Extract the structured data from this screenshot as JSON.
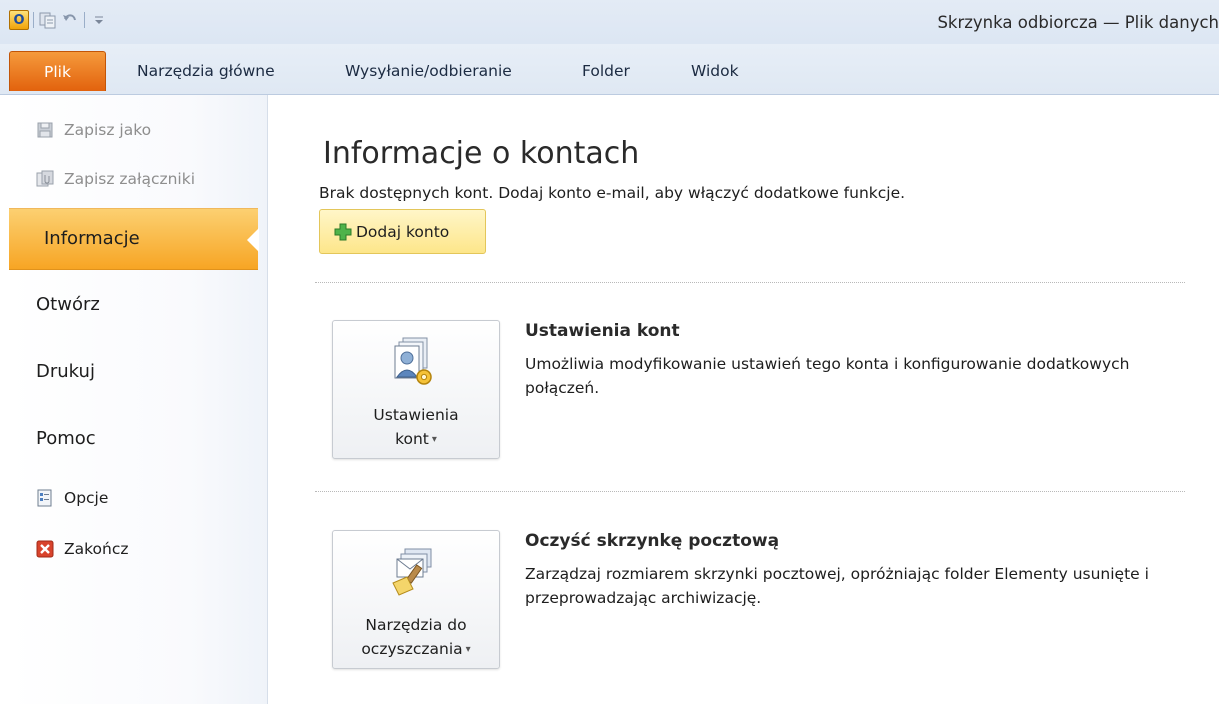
{
  "window": {
    "title": "Skrzynka odbiorcza — Plik danych"
  },
  "quick_access": {
    "icons": [
      "outlook-logo-icon",
      "send-receive-icon",
      "undo-icon",
      "customize-qat-icon"
    ]
  },
  "ribbon": {
    "tabs": [
      {
        "label": "Plik",
        "active": true
      },
      {
        "label": "Narzędzia główne"
      },
      {
        "label": "Wysyłanie/odbieranie"
      },
      {
        "label": "Folder"
      },
      {
        "label": "Widok"
      }
    ]
  },
  "nav": {
    "save_as": "Zapisz jako",
    "save_attachments": "Zapisz załączniki",
    "info": "Informacje",
    "open": "Otwórz",
    "print": "Drukuj",
    "help": "Pomoc",
    "options": "Opcje",
    "exit": "Zakończ"
  },
  "main": {
    "title": "Informacje o kontach",
    "subtitle": "Brak dostępnych kont. Dodaj konto e-mail, aby włączyć dodatkowe funkcje.",
    "add_account_label": "Dodaj konto",
    "sections": [
      {
        "button_line1": "Ustawienia",
        "button_line2": "kont",
        "heading": "Ustawienia kont",
        "description": "Umożliwia modyfikowanie ustawień tego konta i konfigurowanie dodatkowych połączeń."
      },
      {
        "button_line1": "Narzędzia do",
        "button_line2": "oczyszczania",
        "heading": "Oczyść skrzynkę pocztową",
        "description": "Zarządzaj rozmiarem skrzynki pocztowej, opróżniając folder Elementy usunięte i przeprowadzając archiwizację."
      }
    ]
  },
  "colors": {
    "accent_orange": "#f7a524",
    "file_tab": "#e2620d",
    "ribbon_bg": "#dfe8f3"
  }
}
